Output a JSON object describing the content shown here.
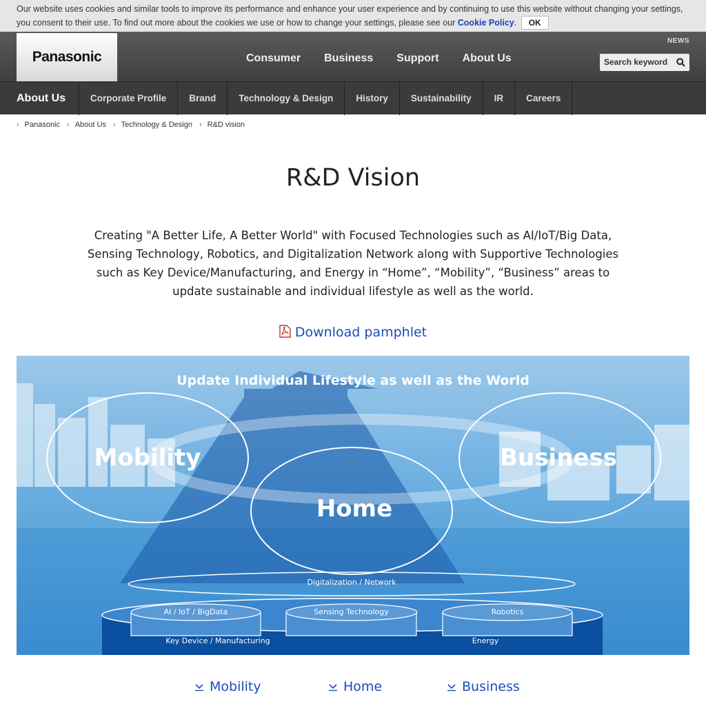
{
  "cookie": {
    "text_line1": "Our website uses cookies and similar tools to improve its performance and enhance your user experience and by continuing to use this website without changing your settings,",
    "text_line2": "you consent to their use. To find out more about the cookies we use or how to change your settings, please see our",
    "link": "Cookie Policy",
    "ok": "OK"
  },
  "header": {
    "logo": "Panasonic",
    "nav": [
      "Consumer",
      "Business",
      "Support",
      "About Us"
    ],
    "news": "NEWS",
    "search_placeholder": "Search keyword"
  },
  "subnav": {
    "title": "About Us",
    "items": [
      "Corporate Profile",
      "Brand",
      "Technology & Design",
      "History",
      "Sustainability",
      "IR",
      "Careers"
    ]
  },
  "breadcrumb": [
    "Panasonic",
    "About Us",
    "Technology & Design",
    "R&D vision"
  ],
  "page": {
    "title": "R&D Vision",
    "lead": "Creating \"A Better Life, A Better World\" with Focused Technologies such as AI/IoT/Big Data, Sensing Technology, Robotics, and Digitalization Network along with Supportive Technologies such as Key Device/Manufacturing, and Energy in “Home”, “Mobility”, “Business” areas to update sustainable and individual lifestyle as well as the world.",
    "pamphlet": "Download pamphlet"
  },
  "hero": {
    "headline": "Update Individual Lifestyle as well as the World",
    "areas": [
      "Mobility",
      "Home",
      "Business"
    ],
    "network": "Digitalization / Network",
    "focused": [
      "AI / IoT / BigData",
      "Sensing Technology",
      "Robotics"
    ],
    "supportive": [
      "Key Device / Manufacturing",
      "Energy"
    ]
  },
  "bottom_links": [
    "Mobility",
    "Home",
    "Business"
  ],
  "colors": {
    "link": "#1d49b8",
    "header_dark": "#3b3b3b",
    "hero_blue": "#3f8fd0",
    "arrow_blue": "#1a5aa8"
  }
}
